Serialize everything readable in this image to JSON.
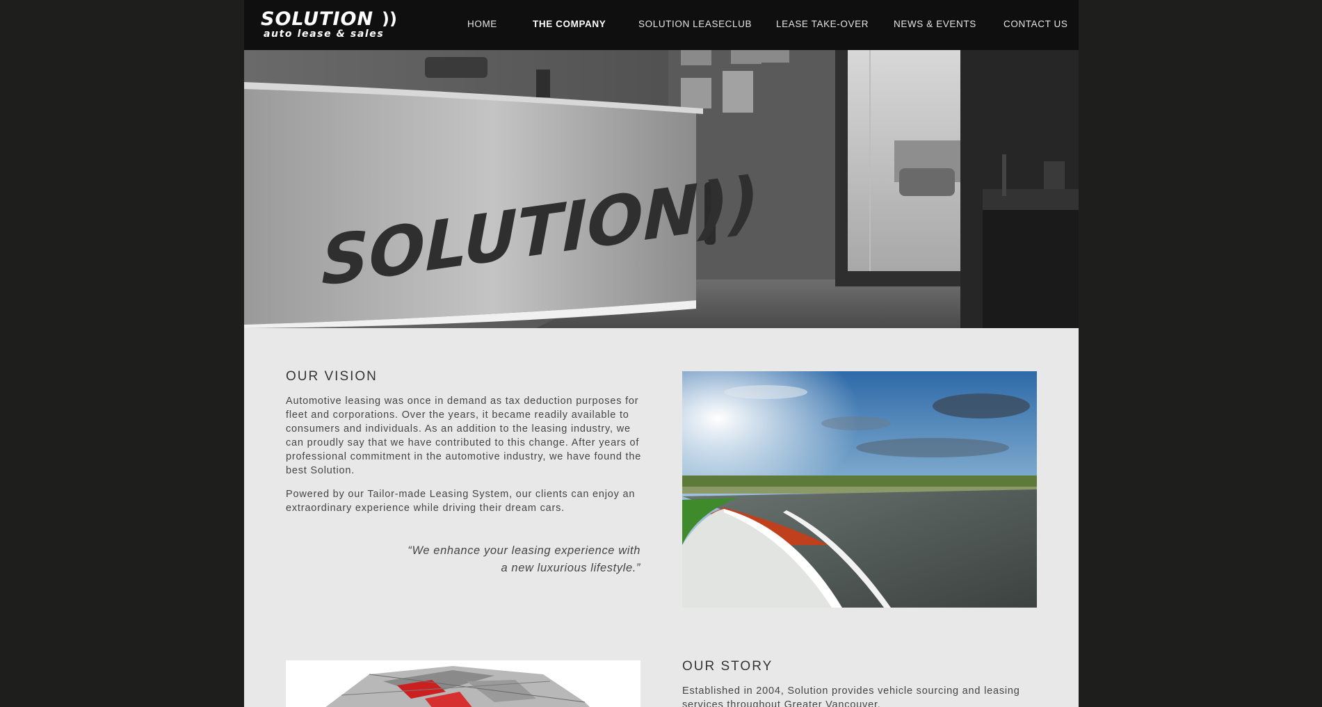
{
  "brand": {
    "name": "SOLUTION",
    "chevron": "))",
    "tagline": "auto lease & sales"
  },
  "nav": {
    "items": [
      {
        "label": "HOME",
        "active": false
      },
      {
        "label": "THE COMPANY",
        "active": true
      },
      {
        "label": "SOLUTION LEASECLUB",
        "active": false
      },
      {
        "label": "LEASE TAKE-OVER",
        "active": false
      },
      {
        "label": "NEWS & EVENTS",
        "active": false
      },
      {
        "label": "CONTACT US",
        "active": false
      }
    ]
  },
  "hero": {
    "wall_sign": "SOLUTION))"
  },
  "vision": {
    "title": "OUR VISION",
    "p1": "Automotive leasing was once in demand as tax deduction purposes for fleet and corporations. Over the years, it became readily available to consumers and individuals. As an addition to the leasing industry, we can proudly say that we have contributed to this change. After years of professional commitment in the automotive industry, we have found the best Solution.",
    "p2": "Powered by our Tailor-made Leasing System, our clients can enjoy an extraordinary experience while driving their dream cars.",
    "quote_line1": "“We enhance your leasing experience with",
    "quote_line2": "a new luxurious lifestyle.”"
  },
  "story": {
    "title": "OUR STORY",
    "p1": "Established in 2004, Solution provides vehicle sourcing and leasing services throughout Greater Vancouver."
  },
  "colors": {
    "page_bg": "#1e1e1c",
    "header_bg": "#0f0f0f",
    "content_bg": "#e8e8e8",
    "track_curb": "#c0401e"
  }
}
